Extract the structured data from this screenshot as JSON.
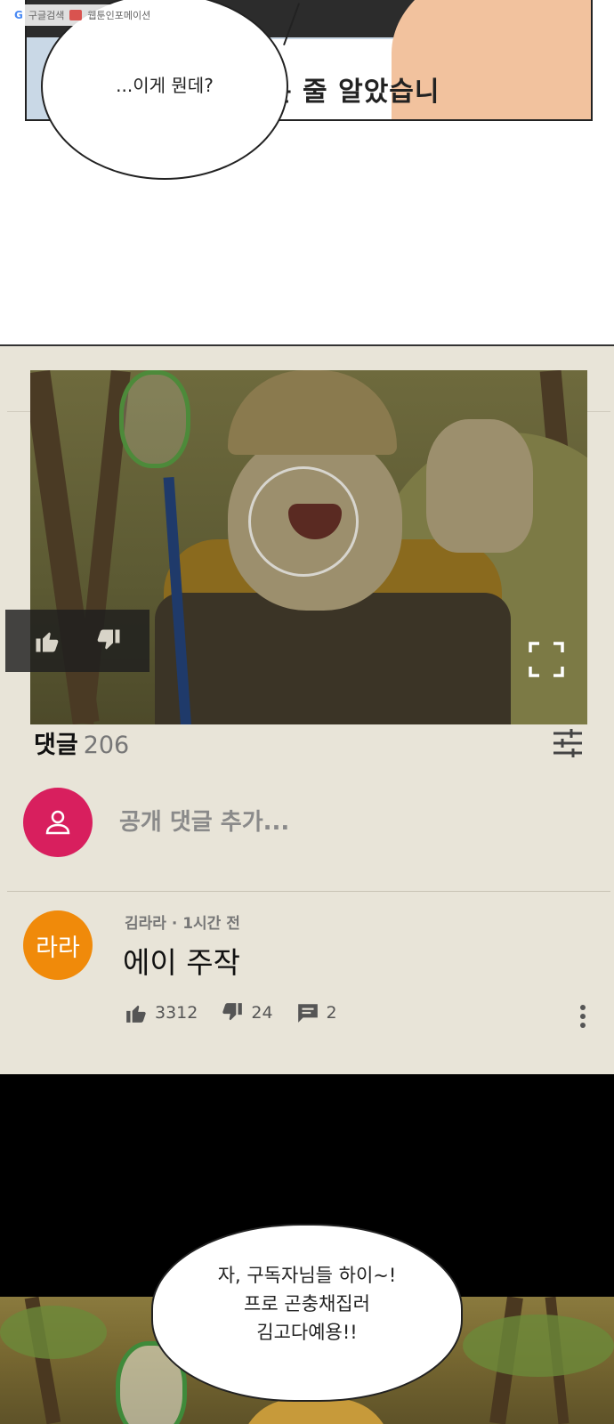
{
  "badge": {
    "search_label": "구글검색",
    "site_label": "웹툰인포메이션"
  },
  "top_panel": {
    "bubble_text": "...이게 뭔데?",
    "caption_text": "는 줄 알았습니"
  },
  "video": {
    "state": "paused"
  },
  "comments": {
    "label": "댓글",
    "count": "206",
    "add_placeholder": "공개 댓글 추가..."
  },
  "comment": {
    "avatar_text": "라라",
    "meta": "김라라 · 1시간 전",
    "body": "에이 주작",
    "likes": "3312",
    "dislikes": "24",
    "replies": "2"
  },
  "bottom_panel": {
    "bubble_lines": [
      "자, 구독자님들 하이~!",
      "프로 곤충채집러",
      "김고다예용!!"
    ]
  },
  "colors": {
    "section_bg": "#e8e4d8",
    "my_avatar": "#d81f5e",
    "commenter_avatar": "#f08a0a"
  }
}
